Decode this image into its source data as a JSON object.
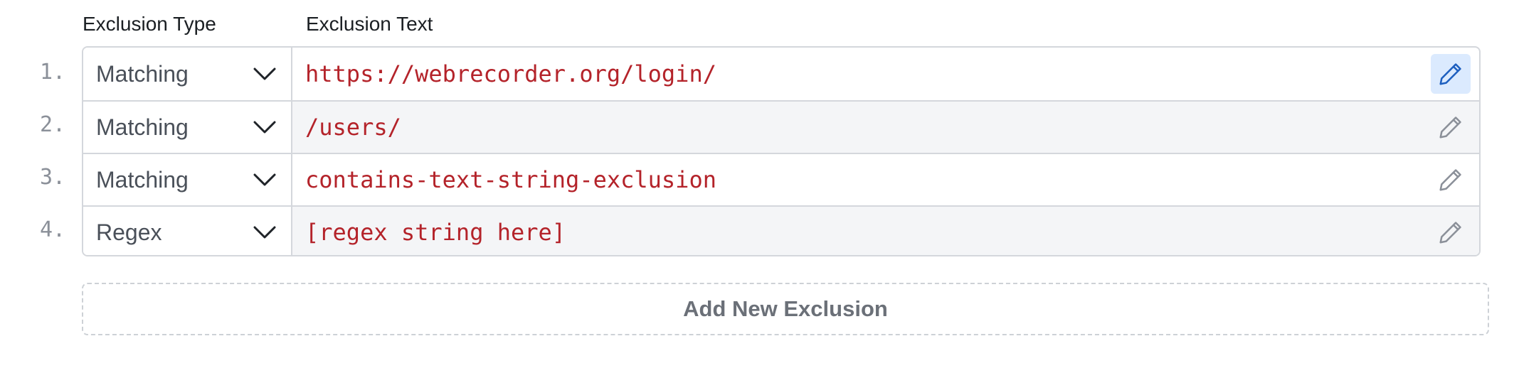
{
  "headers": {
    "type": "Exclusion Type",
    "text": "Exclusion Text"
  },
  "rows": [
    {
      "num": "1.",
      "type": "Matching",
      "text": "https://webrecorder.org/login/",
      "edit_icon": "pencil-icon",
      "active": true
    },
    {
      "num": "2.",
      "type": "Matching",
      "text": "/users/",
      "edit_icon": "pencil-icon",
      "active": false
    },
    {
      "num": "3.",
      "type": "Matching",
      "text": "contains-text-string-exclusion",
      "edit_icon": "pencil-icon",
      "active": false
    },
    {
      "num": "4.",
      "type": "Regex",
      "text": "[regex string here]",
      "edit_icon": "pencil-icon",
      "active": false
    }
  ],
  "add_button": {
    "label": "Add New Exclusion"
  },
  "colors": {
    "exclusion_text": "#b4232a",
    "active_edit_bg": "#dbeafe",
    "active_edit_icon": "#1d5fbf",
    "inactive_edit_icon": "#8b9099",
    "border": "#d4d7dc"
  }
}
